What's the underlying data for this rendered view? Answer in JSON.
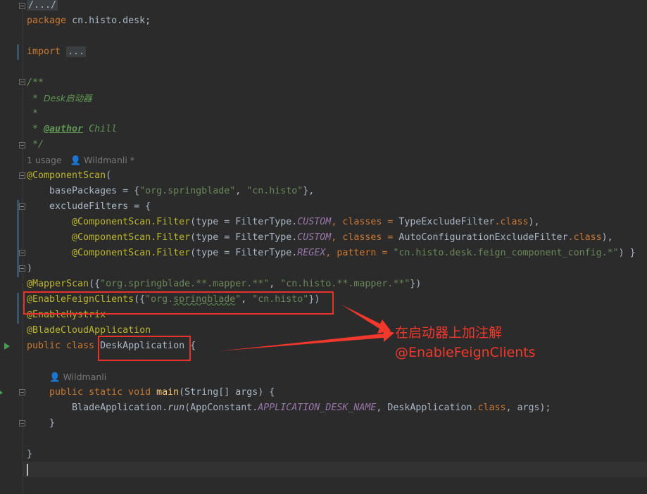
{
  "editor": {
    "line_fold": "/.../",
    "package": {
      "kw": "package",
      "name": "cn.histo.desk;"
    },
    "import": {
      "kw": "import",
      "fold": "..."
    },
    "doc": {
      "open": "/**",
      "desc_prefix": " * ",
      "desc": "Desk启动器",
      "blank": " *",
      "author_prefix": " * ",
      "author_tag": "@author",
      "author_name": " Chill",
      "close": " */"
    },
    "usage_hint": "1 usage",
    "author_hint_1": "Wildmanli *",
    "component_scan": {
      "annotation": "@ComponentScan",
      "open": "(",
      "base_packages_key": "basePackages = {",
      "pkg1": "\"org.springblade\"",
      "sep1": ", ",
      "pkg2": "\"cn.histo\"",
      "close_bp": "},",
      "exclude_key": "excludeFilters = {",
      "filter_ann": "@ComponentScan.Filter",
      "type_eq": "(type = FilterType.",
      "custom": "CUSTOM",
      "regex": "REGEX",
      "classes_eq": ", classes = ",
      "pattern_eq": ", pattern = ",
      "cls1": "TypeExcludeFilter",
      "cls2": "AutoConfigurationExcludeFilter",
      "dot_class": ".class",
      "close_paren": "),",
      "close_paren_last": ")",
      "pattern_str": "\"cn.histo.desk.feign_component_config.*\"",
      "close_filters": " }",
      "close": ")"
    },
    "mapper_scan": {
      "annotation": "@MapperScan",
      "open": "({",
      "p1": "\"org.springblade.**.mapper.**\"",
      "sep": ", ",
      "p2": "\"cn.histo.**.mapper.**\"",
      "close": "})"
    },
    "enable_feign": {
      "annotation": "@EnableFeignClients",
      "open": "({",
      "p1_q1": "\"org.",
      "p1_sq": "springblade",
      "p1_q2": "\"",
      "sep": ", ",
      "p2": "\"cn.histo\"",
      "close": "})"
    },
    "enable_hystrix": "@EnableHystrix",
    "blade_cloud_app": "@BladeCloudApplication",
    "class_decl": {
      "kw": "public class ",
      "name": "DeskApplication",
      "brace": " {"
    },
    "author_hint_2": "Wildmanli",
    "main_decl": {
      "kw": "public static void ",
      "method": "main",
      "params": "(String[] args) {"
    },
    "run_call": {
      "obj": "BladeApplication.",
      "method": "run",
      "arg_open": "(AppConstant.",
      "const": "APPLICATION_DESK_NAME",
      "arg_mid": ", DeskApplication",
      "dot_class": ".class",
      "arg_end": ", args);"
    },
    "close_method": "}",
    "close_class": "}"
  },
  "annotation": {
    "line1": "在启动器上加注解",
    "line2": "@EnableFeignClients",
    "color": "#f2382c"
  }
}
